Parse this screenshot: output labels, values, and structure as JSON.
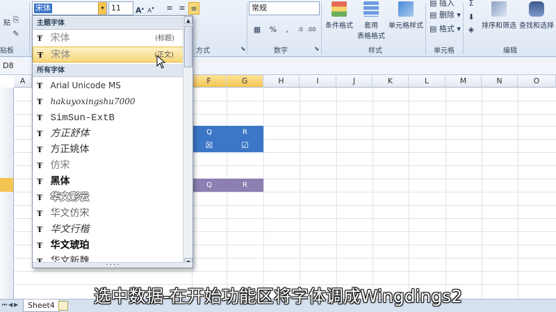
{
  "ribbon": {
    "font_name": "宋体",
    "font_size": "11",
    "number_format": "常规",
    "grow_font": "A",
    "shrink_font": "A",
    "groups": {
      "clipboard": "贴板",
      "alignment": "方式",
      "number": "数字",
      "styles": "样式",
      "cells": "单元格",
      "editing": "编辑"
    },
    "paste_label": "贴",
    "percent": "%",
    "comma": ",",
    "cond_format": "条件格式",
    "table_format_1": "套用",
    "table_format_2": "表格格式",
    "cell_styles": "单元格样式",
    "insert": "插入",
    "delete": "删除",
    "format": "格式",
    "sort_filter": "排序和筛选",
    "find_select": "查找和选择"
  },
  "formula_bar": {
    "name_box": "D8"
  },
  "grid": {
    "columns": [
      "A",
      "F",
      "G",
      "H",
      "I",
      "J",
      "K",
      "L",
      "M",
      "N",
      "O"
    ],
    "cells": {
      "row1_f": "Q",
      "row1_g": "R",
      "row2_f": "☒",
      "row2_g": "☑",
      "row3_f": "Q",
      "row3_g": "R"
    }
  },
  "font_dropdown": {
    "theme_fonts_header": "主题字体",
    "all_fonts_header": "所有字体",
    "theme_fonts": [
      {
        "name": "宋体",
        "tag": "(标题)"
      },
      {
        "name": "宋体",
        "tag": "(正文)"
      }
    ],
    "all_fonts": [
      "Arial Unicode MS",
      "hakuyoxingshu7000",
      "SimSun-ExtB",
      "方正舒体",
      "方正姚体",
      "仿宋",
      "黑体",
      "华文彩云",
      "华文仿宋",
      "华文行楷",
      "华文琥珀",
      "华文新魏"
    ],
    "truetype_glyph": "Ŧ"
  },
  "sheet_tabs": {
    "active": "Sheet4"
  },
  "subtitle": "选中数据-在开始功能区将字体调成Wingdings2",
  "colors": {
    "accent_blue": "#3b77c6",
    "purple": "#8d7fb2",
    "highlight": "#f7d77c"
  }
}
